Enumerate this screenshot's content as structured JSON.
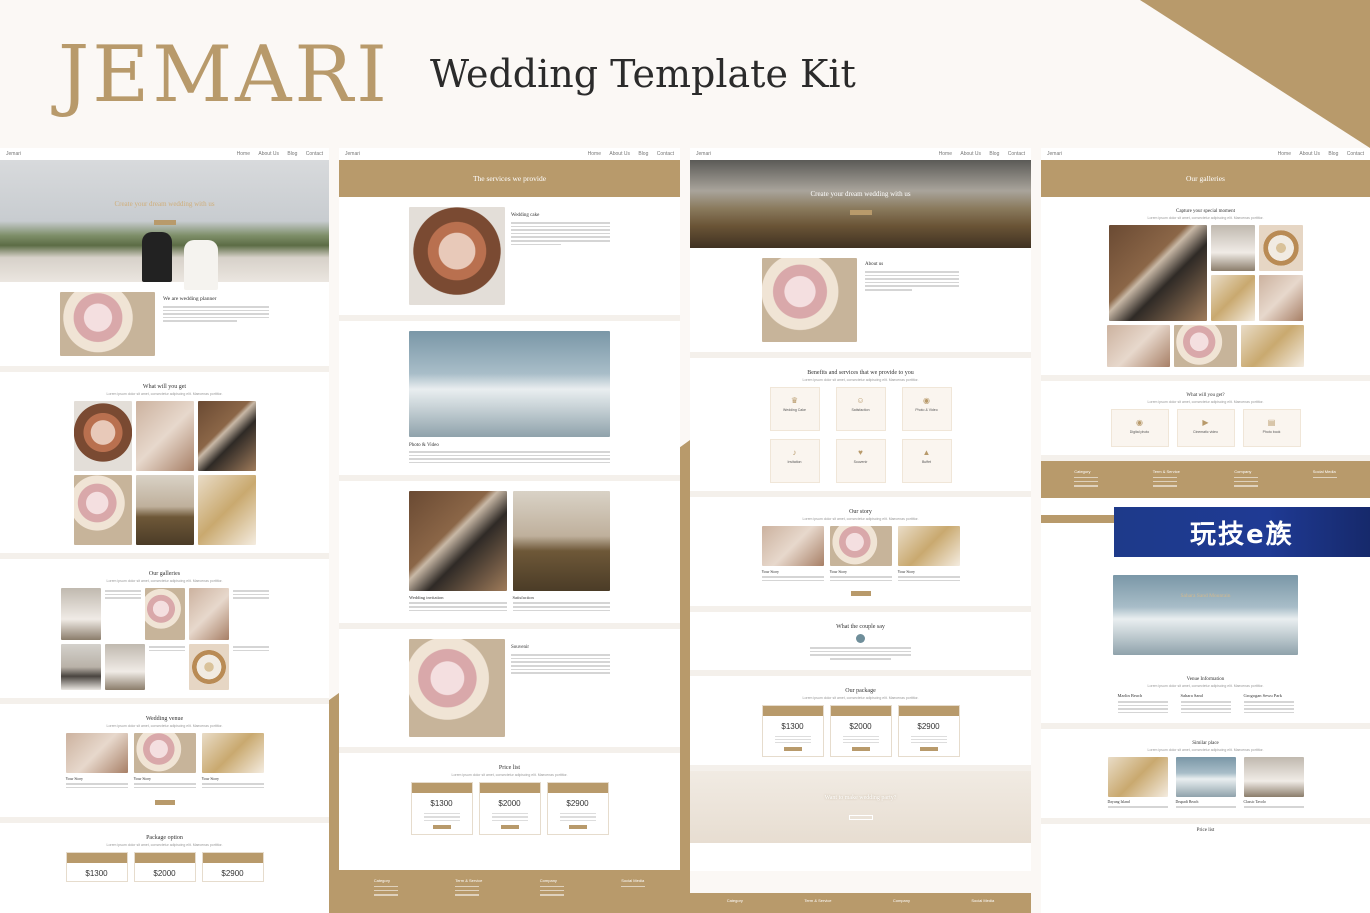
{
  "header": {
    "logo": "JEMARI",
    "title": "Wedding Template Kit"
  },
  "common": {
    "brand": "Jemari",
    "nav": [
      "Home",
      "About Us",
      "Blog",
      "Contact"
    ],
    "lorem": "Lorem ipsum dolor sit amet, consectetur adipiscing elit. Maecenas porttitor."
  },
  "col1": {
    "hero_title": "Create your dream wedding with us",
    "planner_title": "We are wedding planner",
    "what_title": "What will you get",
    "galleries_title": "Our galleries",
    "venues_title": "Wedding venue",
    "story_label": "Your Story",
    "package_title": "Package option",
    "prices": [
      "$1300",
      "$2000",
      "$2900"
    ]
  },
  "col2": {
    "services_title": "The services we provide",
    "cake_title": "Wedding cake",
    "photo_title": "Photo & Video",
    "invitation_title": "Wedding invitation",
    "satisfaction_title": "Satisfaction",
    "souvenir_title": "Souvenir",
    "price_title": "Price list",
    "prices": [
      "$1300",
      "$2000",
      "$2900"
    ],
    "footer": [
      "Category",
      "Term & Service",
      "Company",
      "Social Media"
    ]
  },
  "col3": {
    "hero_title": "Create your dream wedding with us",
    "about_title": "About us",
    "benefits_title": "Benefits and services that we provide to you",
    "services": [
      {
        "icon": "cake-icon",
        "glyph": "♛",
        "label": "Wedding Cake"
      },
      {
        "icon": "smile-icon",
        "glyph": "☺",
        "label": "Satisfaction"
      },
      {
        "icon": "camera-icon",
        "glyph": "◉",
        "label": "Photo & Video"
      },
      {
        "icon": "speaker-icon",
        "glyph": "♪",
        "label": "Invitation"
      },
      {
        "icon": "gift-icon",
        "glyph": "♥",
        "label": "Souvenir"
      },
      {
        "icon": "cake-top-icon",
        "glyph": "▲",
        "label": "Buffet"
      }
    ],
    "story_title": "Our story",
    "story_label": "Your Story",
    "testimonial_title": "What the couple say",
    "package_title": "Our package",
    "prices": [
      "$1300",
      "$2000",
      "$2900"
    ],
    "cta_title": "Want to make wedding party?",
    "footer": [
      "Category",
      "Term & Service",
      "Company",
      "Social Media"
    ]
  },
  "col4": {
    "galleries_title": "Our galleries",
    "capture_title": "Capture your special moment",
    "what_title": "What will you get?",
    "features": [
      "Digital photo",
      "Cinematic video",
      "Photo book"
    ],
    "footer": [
      "Category",
      "Term & Service",
      "Company",
      "Social Media"
    ],
    "banner_text": "玩技e族",
    "venue_hero": "Sahara Sand Mountain",
    "venue_info_title": "Venue Information",
    "venues": [
      "Marlin Beach",
      "Sahara Sand",
      "Grogogan Sewu Park"
    ],
    "similar_title": "Similar place",
    "similar": [
      "Dayung Island",
      "Drupadi Beach",
      "Classic Tavolo"
    ],
    "price_title": "Price list"
  }
}
